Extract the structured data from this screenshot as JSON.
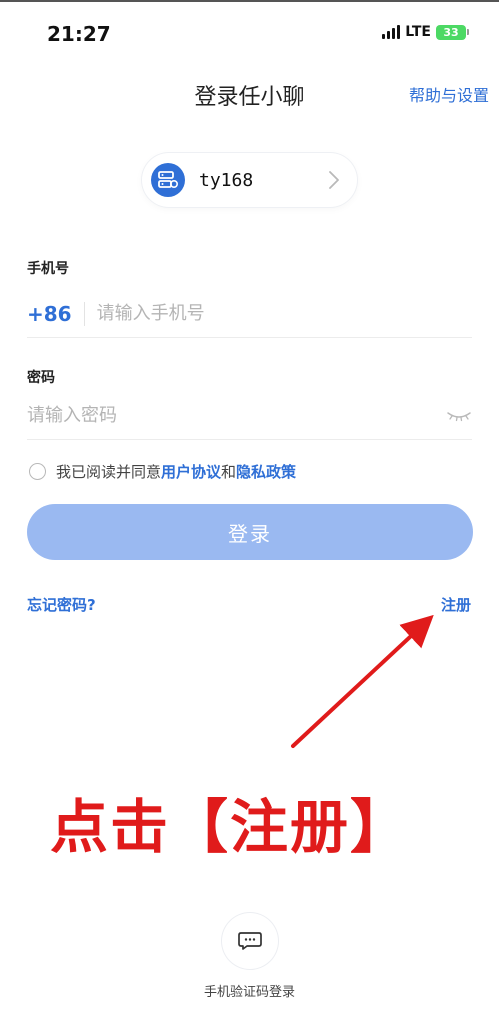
{
  "status_bar": {
    "time": "21:27",
    "network": "LTE",
    "battery": "33"
  },
  "header": {
    "title": "登录任小聊",
    "help_link": "帮助与设置"
  },
  "server": {
    "name": "ty168"
  },
  "phone": {
    "label": "手机号",
    "country_code": "+86",
    "placeholder": "请输入手机号",
    "value": ""
  },
  "password": {
    "label": "密码",
    "placeholder": "请输入密码",
    "value": ""
  },
  "agreement": {
    "prefix": "我已阅读并同意",
    "terms": "用户协议",
    "and": "和",
    "privacy": "隐私政策"
  },
  "actions": {
    "login": "登录",
    "forgot_password": "忘记密码?",
    "register": "注册"
  },
  "annotation": {
    "text": "点击【注册】",
    "color": "#e01b1b"
  },
  "sms_login": {
    "label": "手机验证码登录"
  },
  "colors": {
    "accent": "#2f6fd6",
    "button_disabled": "#9ab9f1"
  }
}
